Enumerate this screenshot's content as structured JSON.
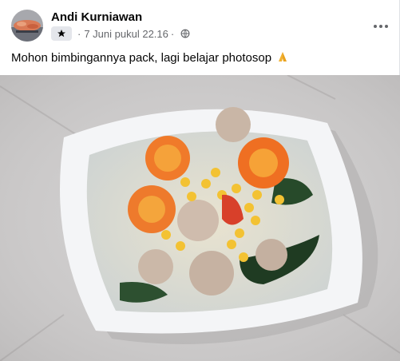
{
  "post": {
    "author": "Andi Kurniawan",
    "separator": "·",
    "timestamp": "7 Juni pukul 22.16",
    "audience_icon": "globe-icon",
    "badge_icon": "star-icon",
    "more_icon": "more-options-icon",
    "caption": "Mohon bimbingannya pack, lagi belajar photosop",
    "caption_emoji_icon": "folded-hands-icon",
    "photo_subject": "photo"
  },
  "colors": {
    "author_text": "#050505",
    "meta_text": "#65676b",
    "badge_bg": "#e4e6eb",
    "tile_bg": "#cfcccc"
  }
}
